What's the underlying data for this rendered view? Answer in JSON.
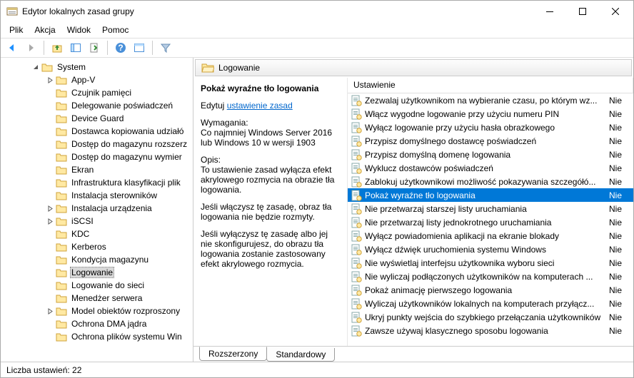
{
  "window": {
    "title": "Edytor lokalnych zasad grupy"
  },
  "menu": {
    "items": [
      "Plik",
      "Akcja",
      "Widok",
      "Pomoc"
    ]
  },
  "tree": {
    "root": "System",
    "selected": "Logowanie",
    "items": [
      "App-V",
      "Czujnik pamięci",
      "Delegowanie poświadczeń",
      "Device Guard",
      "Dostawca kopiowania udziałó",
      "Dostęp do magazynu rozszerz",
      "Dostęp do magazynu wymier",
      "Ekran",
      "Infrastruktura klasyfikacji plik",
      "Instalacja sterowników",
      "Instalacja urządzenia",
      "iSCSI",
      "KDC",
      "Kerberos",
      "Kondycja magazynu",
      "Logowanie",
      "Logowanie do sieci",
      "Menedżer serwera",
      "Model obiektów rozproszony",
      "Ochrona DMA jądra",
      "Ochrona plików systemu Win"
    ]
  },
  "header": {
    "title": "Logowanie"
  },
  "detail": {
    "heading": "Pokaż wyraźne tło logowania",
    "edit_prefix": "Edytuj ",
    "edit_link": "ustawienie zasad",
    "req_label": "Wymagania:",
    "req_value": "Co najmniej Windows Server 2016 lub Windows 10 w wersji 1903",
    "desc_label": "Opis:",
    "desc_value": "To ustawienie zasad wyłącza efekt akrylowego rozmycia na obrazie tła logowania.",
    "para1": "    Jeśli włączysz tę zasadę, obraz tła logowania nie będzie rozmyty.",
    "para2": "    Jeśli wyłączysz tę zasadę albo jej nie skonfigurujesz, do obrazu tła logowania zostanie zastosowany efekt akrylowego rozmycia."
  },
  "list": {
    "col_setting": "Ustawienie",
    "state_label": "Nie",
    "selected_index": 7,
    "rows": [
      "Zezwalaj użytkownikom na wybieranie czasu, po którym wz...",
      "Włącz wygodne logowanie przy użyciu numeru PIN",
      "Wyłącz logowanie przy użyciu hasła obrazkowego",
      "Przypisz domyślnego dostawcę poświadczeń",
      "Przypisz domyślną domenę logowania",
      "Wyklucz dostawców poświadczeń",
      "Zablokuj użytkownikowi możliwość pokazywania szczegółó...",
      "Pokaż wyraźne tło logowania",
      "Nie przetwarzaj starszej listy uruchamiania",
      "Nie przetwarzaj listy jednokrotnego uruchamiania",
      "Wyłącz powiadomienia aplikacji na ekranie blokady",
      "Wyłącz dźwięk uruchomienia systemu Windows",
      "Nie wyświetlaj interfejsu użytkownika wyboru sieci",
      "Nie wyliczaj podłączonych użytkowników na komputerach ...",
      "Pokaż animację pierwszego logowania",
      "Wyliczaj użytkowników lokalnych na komputerach przyłącz...",
      "Ukryj punkty wejścia do szybkiego przełączania użytkowników",
      "Zawsze używaj klasycznego sposobu logowania"
    ]
  },
  "tabs": {
    "extended": "Rozszerzony",
    "standard": "Standardowy"
  },
  "status": {
    "count_label": "Liczba ustawień: 22"
  }
}
